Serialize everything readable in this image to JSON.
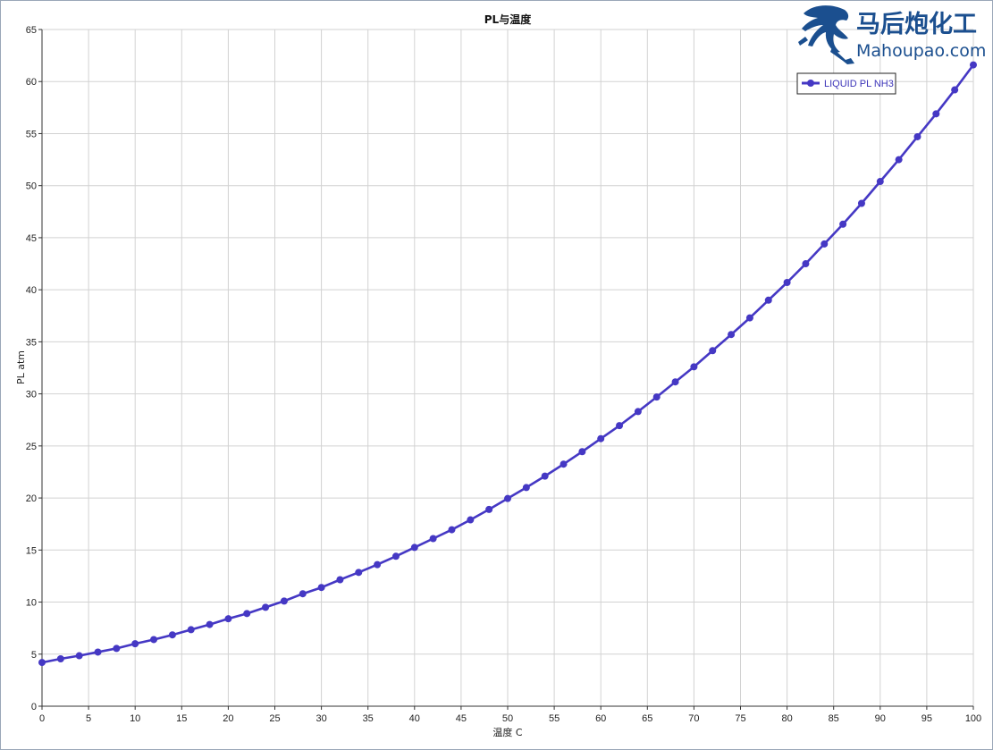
{
  "colors": {
    "series": "#4538c4",
    "grid": "#d2d2d2",
    "axis": "#333333",
    "logo": "#1b4f8f"
  },
  "logo": {
    "cn": "马后炮化工",
    "en": "Mahoupao.com"
  },
  "chart_data": {
    "type": "line",
    "title": "PL与温度",
    "xlabel": "温度 C",
    "ylabel": "PL atm",
    "xlim": [
      0,
      100
    ],
    "ylim": [
      0,
      65
    ],
    "xticks": [
      0,
      5,
      10,
      15,
      20,
      25,
      30,
      35,
      40,
      45,
      50,
      55,
      60,
      65,
      70,
      75,
      80,
      85,
      90,
      95,
      100
    ],
    "yticks": [
      0,
      5,
      10,
      15,
      20,
      25,
      30,
      35,
      40,
      45,
      50,
      55,
      60,
      65
    ],
    "grid": true,
    "legend_position": "top-right",
    "series": [
      {
        "name": "LIQUID PL NH3",
        "marker": "circle",
        "x": [
          0,
          2,
          4,
          6,
          8,
          10,
          12,
          14,
          16,
          18,
          20,
          22,
          24,
          26,
          28,
          30,
          32,
          34,
          36,
          38,
          40,
          42,
          44,
          46,
          48,
          50,
          52,
          54,
          56,
          58,
          60,
          62,
          64,
          66,
          68,
          70,
          72,
          74,
          76,
          78,
          80,
          82,
          84,
          86,
          88,
          90,
          92,
          94,
          96,
          98,
          100
        ],
        "y": [
          4.2,
          4.55,
          4.85,
          5.2,
          5.55,
          6.0,
          6.4,
          6.85,
          7.35,
          7.85,
          8.4,
          8.9,
          9.5,
          10.1,
          10.8,
          11.4,
          12.15,
          12.85,
          13.6,
          14.4,
          15.25,
          16.1,
          16.95,
          17.9,
          18.9,
          19.95,
          21.0,
          22.1,
          23.25,
          24.45,
          25.7,
          26.95,
          28.3,
          29.7,
          31.15,
          32.6,
          34.15,
          35.7,
          37.3,
          39.0,
          40.7,
          42.5,
          44.4,
          46.3,
          48.3,
          50.4,
          52.5,
          54.7,
          56.9,
          59.2,
          61.6
        ]
      }
    ]
  }
}
